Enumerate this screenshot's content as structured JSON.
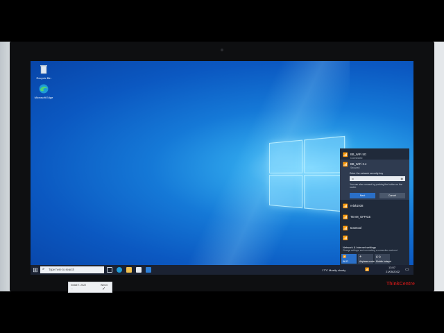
{
  "desktop": {
    "icons": [
      {
        "label": "Recycle Bin",
        "icon": "recycle-bin-icon"
      },
      {
        "label": "Microsoft Edge",
        "icon": "edge-icon"
      }
    ]
  },
  "taskbar": {
    "search_placeholder": "Type here to search",
    "weather": "17°C  Mostly cloudy",
    "time": "13:57",
    "date": "21/05/2022",
    "apps": [
      "task-view-icon",
      "edge-icon",
      "file-explorer-icon",
      "store-icon",
      "mail-icon"
    ]
  },
  "network_flyout": {
    "networks": [
      {
        "name": "BB_WiFi 5G",
        "status": "Connected"
      },
      {
        "name": "BB_WiFi 2.4",
        "status": "Secured"
      },
      {
        "name": "relak1938",
        "status": ""
      },
      {
        "name": "TEAM_OFFICE",
        "status": ""
      },
      {
        "name": "teamtool",
        "status": ""
      }
    ],
    "key_prompt": "Enter the network security key",
    "key_value": "••",
    "hint": "You can also connect by pushing the button on the router.",
    "next_label": "Next",
    "cancel_label": "Cancel",
    "settings_link": "Network & Internet settings",
    "settings_sub": "Change settings, such as making a connection metered.",
    "quick_actions": [
      {
        "label": "Wi-Fi",
        "active": true
      },
      {
        "label": "Airplane mode",
        "active": false
      },
      {
        "label": "Mobile hotspot",
        "active": false
      }
    ]
  },
  "monitor": {
    "brand": "ThinkCentre"
  },
  "sticker": {
    "line1": "Install T. 2022",
    "line2": "...",
    "line3": "Win10"
  },
  "colors": {
    "accent": "#2a6fc7",
    "taskbar": "#1b2232",
    "flyout": "#202a3a"
  }
}
